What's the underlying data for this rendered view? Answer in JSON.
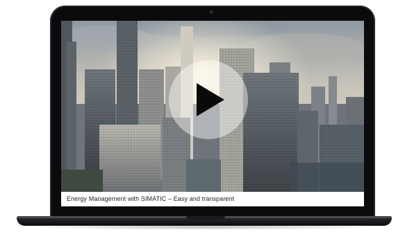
{
  "video": {
    "caption": "Energy Management with SIMATIC – Easy and transparent",
    "play_button": "play-icon"
  },
  "colors": {
    "bezel": "#0b0b0d",
    "caption_background": "#ffffff",
    "play_overlay": "rgba(255,255,255,0.45)"
  }
}
